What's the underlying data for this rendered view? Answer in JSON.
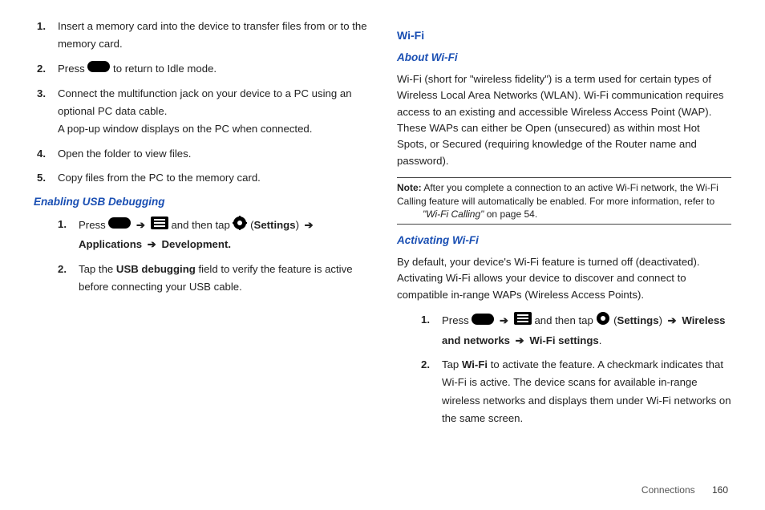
{
  "left": {
    "steps": [
      {
        "n": "1.",
        "text": "Insert a memory card into the device to transfer files from or to the memory card."
      },
      {
        "n": "2.",
        "text_before": "Press ",
        "text_after": " to return to Idle mode."
      },
      {
        "n": "3.",
        "text": "Connect the multifunction jack on your device to a PC using an optional PC data cable.\nA pop-up window displays on the PC when connected."
      },
      {
        "n": "4.",
        "text": "Open the folder to view files."
      },
      {
        "n": "5.",
        "text": "Copy files from the PC to the memory card."
      }
    ],
    "h_usb": "Enabling USB Debugging",
    "usb_steps": {
      "s1": {
        "n": "1.",
        "press": "Press ",
        "and_tap": " and then tap ",
        "settings_open": " (",
        "settings": "Settings",
        "settings_close": ") ",
        "apps": "Applications ",
        "dev": " Development."
      },
      "s2": {
        "n": "2.",
        "t1": "Tap the ",
        "t2": "USB debugging",
        "t3": " field to verify the feature is active before connecting your USB cable."
      }
    }
  },
  "right": {
    "h_wifi": "Wi-Fi",
    "h_about": "About Wi-Fi",
    "about_text": "Wi-Fi (short for \"wireless fidelity\") is a term used for certain types of Wireless Local Area Networks (WLAN). Wi-Fi communication requires access to an existing and accessible Wireless Access Point (WAP). These WAPs can either be Open (unsecured) as within most Hot Spots, or Secured (requiring knowledge of the Router name and password).",
    "note": {
      "label": "Note:",
      "t1": " After you complete a connection to an active Wi-Fi network, the Wi-Fi Calling feature will automatically be enabled. For more information, refer to ",
      "em": "\"Wi-Fi Calling\"",
      "t2": "  on page 54."
    },
    "h_act": "Activating Wi-Fi",
    "act_text": "By default, your device's Wi-Fi feature is turned off (deactivated). Activating Wi-Fi allows your device to discover and connect to compatible in-range WAPs (Wireless Access Points).",
    "act_steps": {
      "s1": {
        "n": "1.",
        "press": "Press ",
        "and_tap": " and then tap ",
        "settings_open": " (",
        "settings": "Settings",
        "settings_close": ") ",
        "wn": "Wireless and networks ",
        "ws": " Wi-Fi settings",
        "dot": "."
      },
      "s2": {
        "n": "2.",
        "t1": "Tap ",
        "t2": "Wi-Fi",
        "t3": " to activate the feature. A checkmark indicates that Wi-Fi is active. The device scans for available in-range wireless networks and displays them under Wi-Fi networks on the same screen."
      }
    }
  },
  "footer": {
    "section": "Connections",
    "page": "160"
  },
  "arrow": "➔"
}
